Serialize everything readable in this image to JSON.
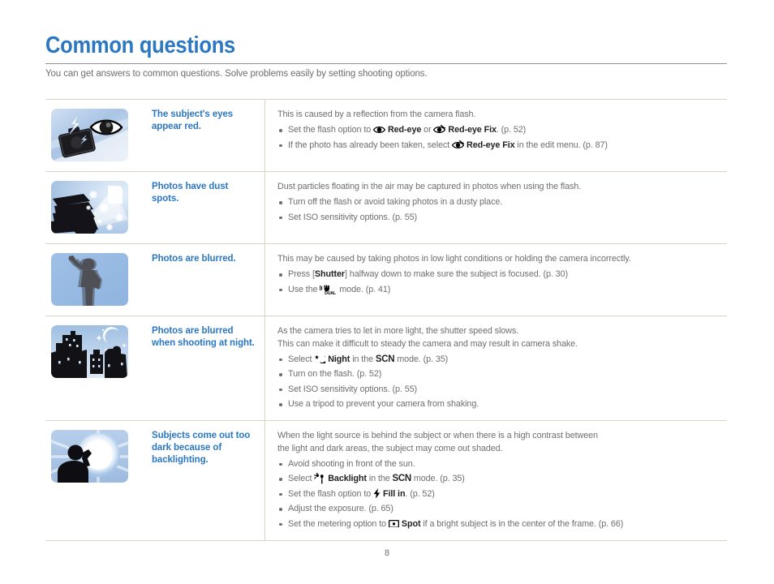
{
  "header": {
    "title": "Common questions",
    "subtitle": "You can get answers to common questions. Solve problems easily by setting shooting options."
  },
  "colors": {
    "heading_blue": "#2c77c2",
    "body_gray": "#6d6e71",
    "bold_black": "#231f20",
    "rule": "#d9d2c4"
  },
  "rows": [
    {
      "thumb_name": "red-eye-thumbnail",
      "question": "The subject's eyes appear red.",
      "lead": "This is caused by a reflection from the camera flash.",
      "bullets": [
        {
          "segments": [
            {
              "t": "text",
              "v": "Set the flash option to "
            },
            {
              "t": "icon",
              "v": "red-eye-icon"
            },
            {
              "t": "bold",
              "v": " Red-eye"
            },
            {
              "t": "text",
              "v": " or "
            },
            {
              "t": "icon",
              "v": "red-eye-fix-icon"
            },
            {
              "t": "bold",
              "v": " Red-eye Fix"
            },
            {
              "t": "text",
              "v": ". (p. 52)"
            }
          ]
        },
        {
          "segments": [
            {
              "t": "text",
              "v": "If the photo has already been taken, select "
            },
            {
              "t": "icon",
              "v": "red-eye-fix-icon"
            },
            {
              "t": "bold",
              "v": " Red-eye Fix"
            },
            {
              "t": "text",
              "v": " in the edit menu. (p. 87)"
            }
          ]
        }
      ]
    },
    {
      "thumb_name": "dust-spots-thumbnail",
      "question": "Photos have dust spots.",
      "lead": "Dust particles floating in the air may be captured in photos when using the flash.",
      "bullets": [
        {
          "segments": [
            {
              "t": "text",
              "v": "Turn off the flash or avoid taking photos in a dusty place."
            }
          ]
        },
        {
          "segments": [
            {
              "t": "text",
              "v": "Set ISO sensitivity options. (p. 55)"
            }
          ]
        }
      ]
    },
    {
      "thumb_name": "blurred-photo-thumbnail",
      "question": "Photos are blurred.",
      "lead": "This may be caused by taking photos in low light conditions or holding the camera incorrectly.",
      "bullets": [
        {
          "segments": [
            {
              "t": "text",
              "v": "Press ["
            },
            {
              "t": "bold",
              "v": "Shutter"
            },
            {
              "t": "text",
              "v": "] halfway down to make sure the subject is focused. (p. 30)"
            }
          ]
        },
        {
          "segments": [
            {
              "t": "text",
              "v": "Use the "
            },
            {
              "t": "icon",
              "v": "dual-is-icon"
            },
            {
              "t": "text",
              "v": " mode. (p. 41)"
            }
          ]
        }
      ]
    },
    {
      "thumb_name": "night-scene-thumbnail",
      "question": "Photos are blurred when shooting at night.",
      "lead": "As the camera tries to let in more light, the shutter speed slows.\nThis can make it difficult to steady the camera and may result in camera shake.",
      "bullets": [
        {
          "segments": [
            {
              "t": "text",
              "v": "Select "
            },
            {
              "t": "icon",
              "v": "night-mode-icon"
            },
            {
              "t": "bold",
              "v": " Night"
            },
            {
              "t": "text",
              "v": " in the "
            },
            {
              "t": "scn",
              "v": "SCN"
            },
            {
              "t": "text",
              "v": " mode. (p. 35)"
            }
          ]
        },
        {
          "segments": [
            {
              "t": "text",
              "v": "Turn on the flash. (p. 52)"
            }
          ]
        },
        {
          "segments": [
            {
              "t": "text",
              "v": "Set ISO sensitivity options. (p. 55)"
            }
          ]
        },
        {
          "segments": [
            {
              "t": "text",
              "v": "Use a tripod to prevent your camera from shaking."
            }
          ]
        }
      ]
    },
    {
      "thumb_name": "backlight-thumbnail",
      "question": "Subjects come out too dark because of backlighting.",
      "lead": "When the light source is behind the subject or when there is a high contrast between\nthe light and dark areas, the subject may come out shaded.",
      "bullets": [
        {
          "segments": [
            {
              "t": "text",
              "v": "Avoid shooting in front of the sun."
            }
          ]
        },
        {
          "segments": [
            {
              "t": "text",
              "v": "Select "
            },
            {
              "t": "icon",
              "v": "backlight-mode-icon"
            },
            {
              "t": "bold",
              "v": " Backlight"
            },
            {
              "t": "text",
              "v": " in the "
            },
            {
              "t": "scn",
              "v": "SCN"
            },
            {
              "t": "text",
              "v": " mode. (p. 35)"
            }
          ]
        },
        {
          "segments": [
            {
              "t": "text",
              "v": "Set the flash option to "
            },
            {
              "t": "icon",
              "v": "fill-in-flash-icon"
            },
            {
              "t": "bold",
              "v": " Fill in"
            },
            {
              "t": "text",
              "v": ". (p. 52)"
            }
          ]
        },
        {
          "segments": [
            {
              "t": "text",
              "v": "Adjust the exposure. (p. 65)"
            }
          ]
        },
        {
          "segments": [
            {
              "t": "text",
              "v": "Set the metering option to "
            },
            {
              "t": "icon",
              "v": "spot-metering-icon"
            },
            {
              "t": "bold",
              "v": " Spot"
            },
            {
              "t": "text",
              "v": " if a bright subject is in the center of the frame. (p. 66)"
            }
          ]
        }
      ]
    }
  ],
  "footer": {
    "page_number": "8"
  }
}
